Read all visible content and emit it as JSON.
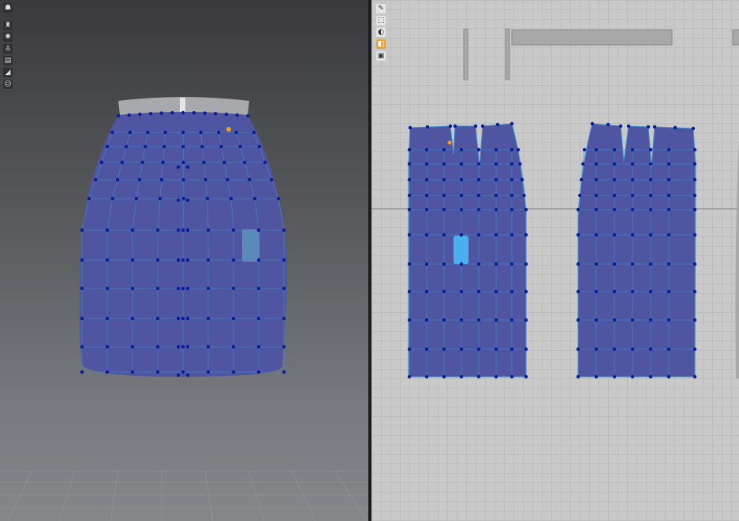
{
  "panels": {
    "viewport_3d": {
      "name": "3D garment view"
    },
    "pattern_2d": {
      "name": "2D pattern view"
    }
  },
  "toolbar_3d": [
    {
      "icon": "avatar-icon",
      "glyph": "☗"
    },
    {
      "icon": "garment-icon",
      "glyph": "♜"
    },
    {
      "icon": "simulation-icon",
      "glyph": "✺"
    },
    {
      "icon": "user-icon",
      "glyph": "♙"
    },
    {
      "icon": "layers-icon",
      "glyph": "▤"
    },
    {
      "icon": "measure-icon",
      "glyph": "◢"
    },
    {
      "icon": "face-icon",
      "glyph": "☺"
    }
  ],
  "toolbar_2d": [
    {
      "icon": "pen-icon",
      "glyph": "✎"
    },
    {
      "icon": "transform-icon",
      "glyph": "⬚"
    },
    {
      "icon": "sewing-icon",
      "glyph": "◐"
    },
    {
      "icon": "fold-icon",
      "glyph": "◧",
      "active": true
    },
    {
      "icon": "texture-icon",
      "glyph": "▣"
    }
  ],
  "colors": {
    "fabric": "#4f55a0",
    "mesh_line": "#3a8fd0",
    "vertex": "#0d1a9a",
    "selected": "#4ab0f0",
    "pin": "#f0a020",
    "waistband": "#a8a9ad"
  }
}
